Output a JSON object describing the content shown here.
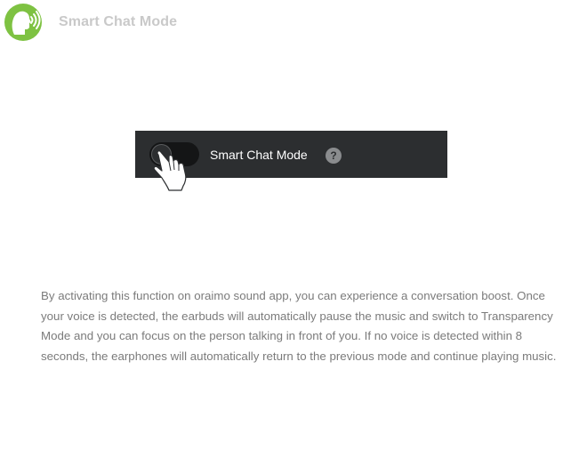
{
  "header": {
    "title": "Smart Chat Mode",
    "icon": "speaking-head-icon",
    "accent_color": "#7ec242"
  },
  "demo": {
    "toggle_label": "Smart Chat Mode",
    "toggle_state": "off",
    "help_symbol": "?",
    "bar_color": "#2c2e30"
  },
  "description": "By activating this function on oraimo sound app, you can experience a conversation boost. Once your voice is detected, the earbuds will automatically pause the music and switch to Transparency Mode and you can focus on the person talking in front of you. If no voice is detected within 8 seconds, the earphones will automatically return to the previous mode and continue playing music."
}
